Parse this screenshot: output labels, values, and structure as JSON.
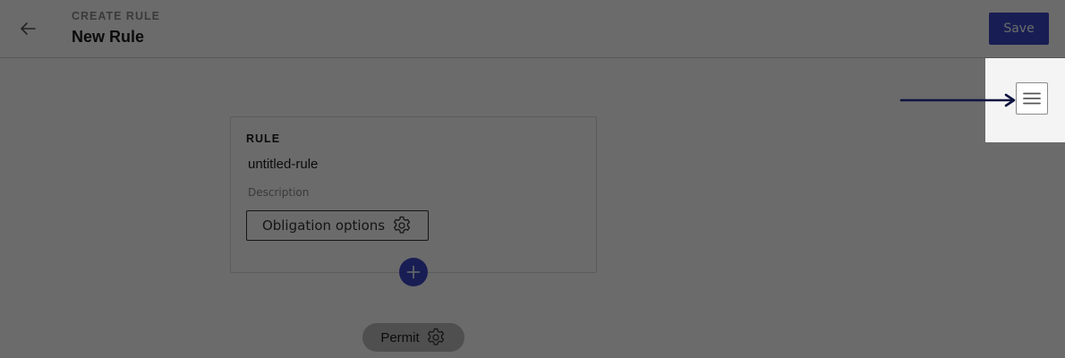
{
  "header": {
    "eyebrow": "CREATE RULE",
    "title": "New Rule",
    "save_label": "Save",
    "back_icon": "arrow-left-icon"
  },
  "rule_card": {
    "type_label": "RULE",
    "name": "untitled-rule",
    "description_placeholder": "Description",
    "obligation_label": "Obligation options",
    "obligation_icon": "gear-icon"
  },
  "add_button": {
    "icon": "plus-icon"
  },
  "permit": {
    "label": "Permit",
    "icon": "gear-icon"
  },
  "highlight": {
    "menu_icon": "hamburger-menu-icon",
    "pointer_icon": "arrow-right-icon"
  },
  "colors": {
    "primary": "#3949c7",
    "overlay": "#000000",
    "arrow": "#0f1440"
  }
}
